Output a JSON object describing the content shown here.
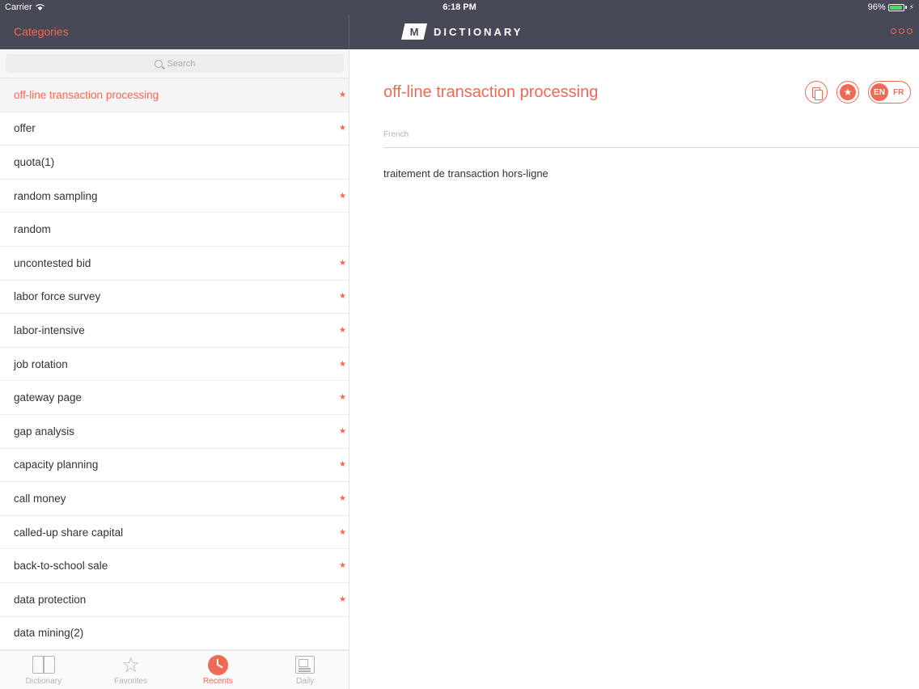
{
  "status_bar": {
    "carrier": "Carrier",
    "time": "6:18 PM",
    "battery": "96%",
    "battery_level": 0.96
  },
  "nav": {
    "categories_label": "Categories",
    "logo_letter": "M",
    "logo_text": "DICTIONARY"
  },
  "search": {
    "placeholder": "Search"
  },
  "word_list": [
    {
      "label": "off-line transaction processing",
      "starred": true,
      "selected": true
    },
    {
      "label": "offer",
      "starred": true
    },
    {
      "label": "quota(1)",
      "starred": false
    },
    {
      "label": "random sampling",
      "starred": true
    },
    {
      "label": "random",
      "starred": false
    },
    {
      "label": "uncontested bid",
      "starred": true
    },
    {
      "label": "labor force survey",
      "starred": true
    },
    {
      "label": "labor-intensive",
      "starred": true
    },
    {
      "label": "job rotation",
      "starred": true
    },
    {
      "label": "gateway page",
      "starred": true
    },
    {
      "label": "gap analysis",
      "starred": true
    },
    {
      "label": "capacity planning",
      "starred": true
    },
    {
      "label": "call money",
      "starred": true
    },
    {
      "label": "called-up share capital",
      "starred": true
    },
    {
      "label": "back-to-school sale",
      "starred": true
    },
    {
      "label": "data protection",
      "starred": true
    },
    {
      "label": "data mining(2)",
      "starred": false
    }
  ],
  "tabs": [
    {
      "label": "Dictionary",
      "icon": "book-icon",
      "active": false
    },
    {
      "label": "Favorites",
      "icon": "star-icon",
      "active": false
    },
    {
      "label": "Recents",
      "icon": "clock-icon",
      "active": true
    },
    {
      "label": "Daily",
      "icon": "newspaper-icon",
      "active": false
    }
  ],
  "entry": {
    "title": "off-line transaction processing",
    "section_label": "French",
    "translation": "traitement de transaction hors-ligne",
    "lang_active": "EN",
    "lang_other": "FR"
  },
  "colors": {
    "accent": "#ee6a55",
    "nav_background": "#474956",
    "battery": "#4cd964"
  }
}
